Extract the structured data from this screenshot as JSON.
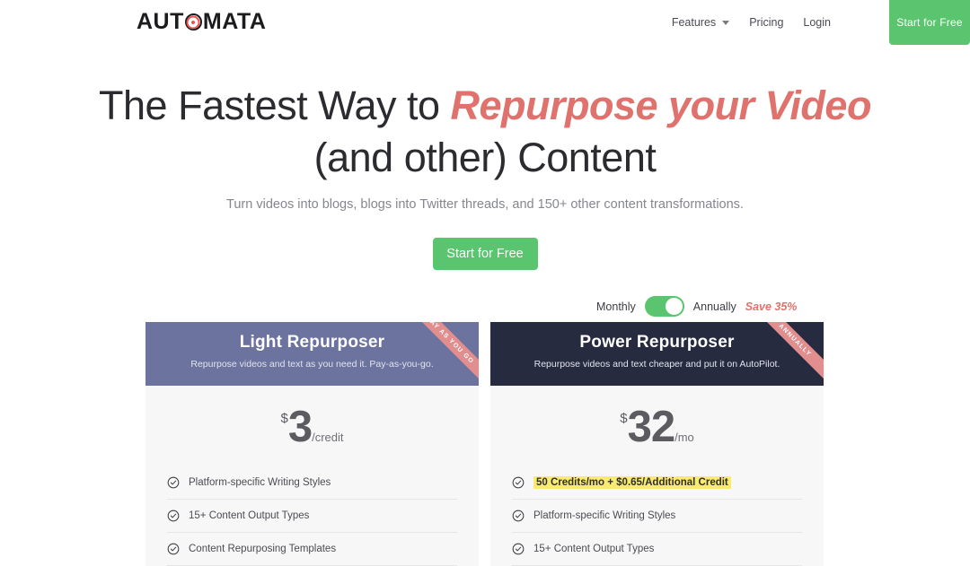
{
  "header": {
    "logo": {
      "before": "AUT",
      "icon": "target-icon",
      "after": "MATA"
    },
    "nav": [
      {
        "label": "Features",
        "has_caret": true
      },
      {
        "label": "Pricing",
        "has_caret": false
      },
      {
        "label": "Login",
        "has_caret": false
      }
    ],
    "cta_label": "Start for Free"
  },
  "hero": {
    "title_part1": "The Fastest Way to ",
    "title_accent": "Repurpose your Video",
    "title_line2": "(and other) Content",
    "subtitle": "Turn videos into blogs, blogs into Twitter threads, and 150+ other content transformations.",
    "cta_label": "Start for Free"
  },
  "billing": {
    "monthly_label": "Monthly",
    "annually_label": "Annually",
    "save_label": "Save 35%",
    "selected": "Annually"
  },
  "pricing": {
    "cards": [
      {
        "title": "Light Repurposer",
        "subtitle": "Repurpose videos and text as you need it. Pay-as-you-go.",
        "ribbon": "PAY AS YOU GO",
        "currency": "$",
        "amount": "3",
        "unit": "/credit",
        "features": [
          {
            "text": "Platform-specific Writing Styles",
            "highlight": false
          },
          {
            "text": "15+ Content Output Types",
            "highlight": false
          },
          {
            "text": "Content Repurposing Templates",
            "highlight": false
          }
        ]
      },
      {
        "title": "Power Repurposer",
        "subtitle": "Repurpose videos and text cheaper and put it on AutoPilot.",
        "ribbon": "ANNUALLY",
        "currency": "$",
        "amount": "32",
        "unit": "/mo",
        "features": [
          {
            "text": "50 Credits/mo + $0.65/Additional Credit",
            "highlight": true
          },
          {
            "text": "Platform-specific Writing Styles",
            "highlight": false
          },
          {
            "text": "15+ Content Output Types",
            "highlight": false
          }
        ]
      }
    ]
  },
  "colors": {
    "brand_green": "#5ac46e",
    "accent_red": "#e0726d",
    "card_light_header": "#6c739f",
    "card_dark_header": "#262b40",
    "ribbon": "#e28e8e",
    "highlight_yellow": "#faea70"
  }
}
